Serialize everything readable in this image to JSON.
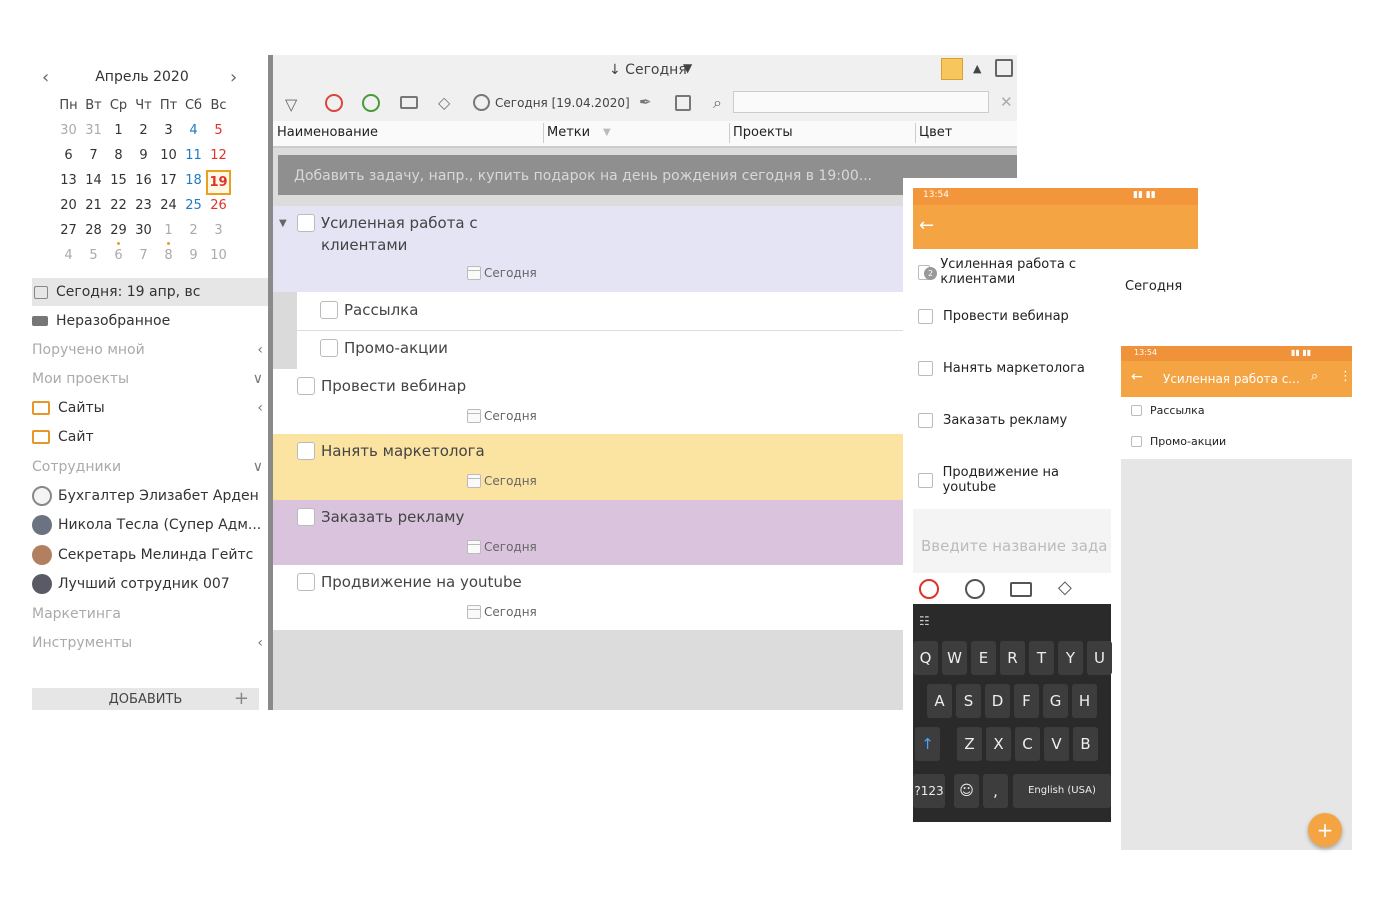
{
  "calendar": {
    "title": "Апрель 2020",
    "weekdays": [
      "Пн",
      "Вт",
      "Ср",
      "Чт",
      "Пт",
      "Сб",
      "Вс"
    ],
    "weeks": [
      [
        "30",
        "31",
        "1",
        "2",
        "3",
        "4",
        "5"
      ],
      [
        "6",
        "7",
        "8",
        "9",
        "10",
        "11",
        "12"
      ],
      [
        "13",
        "14",
        "15",
        "16",
        "17",
        "18",
        "19"
      ],
      [
        "20",
        "21",
        "22",
        "23",
        "24",
        "25",
        "26"
      ],
      [
        "27",
        "28",
        "29",
        "30",
        "1",
        "2",
        "3"
      ],
      [
        "4",
        "5",
        "6",
        "7",
        "8",
        "9",
        "10"
      ]
    ],
    "today": "19"
  },
  "sidebar": {
    "today": "Сегодня: 19 апр, вс",
    "unsorted": "Неразобранное",
    "assigned": "Поручено мной",
    "my_projects": "Мои проекты",
    "sites": "Сайты",
    "site": "Сайт",
    "employees": "Сотрудники",
    "people": [
      "Бухгалтер Элизабет Арден",
      "Никола Тесла (Супер Адм...",
      "Секретарь Мелинда Гейтс",
      "Лучший сотрудник 007"
    ],
    "marketing": "Маркетинга",
    "tools": "Инструменты",
    "add": "ДОБАВИТЬ"
  },
  "main": {
    "sort_label": "↓ Сегодня",
    "date_filter": "Сегодня [19.04.2020]",
    "columns": [
      "Наименование",
      "Метки",
      "Проекты",
      "Цвет"
    ],
    "add_placeholder": "Добавить задачу, напр., купить подарок на день рождения сегодня в 19:00...",
    "due": "Сегодня",
    "tasks": [
      {
        "title": "Усиленная работа с",
        "title2": "клиентами"
      },
      {
        "title": "Рассылка"
      },
      {
        "title": "Промо-акции"
      },
      {
        "title": "Провести вебинар"
      },
      {
        "title": "Нанять маркетолога"
      },
      {
        "title": "Заказать рекламу"
      },
      {
        "title": "Продвижение на youtube"
      }
    ]
  },
  "phone1": {
    "time": "13:54",
    "items": [
      "Усиленная работа с клиентами",
      "Провести вебинар",
      "Нанять маркетолога",
      "Заказать рекламу",
      "Продвижение на youtube"
    ],
    "due": "Сегодня",
    "badge": "2",
    "input_placeholder": "Введите название зада",
    "keys_row1": [
      "Q",
      "W",
      "E",
      "R",
      "T",
      "Y",
      "U"
    ],
    "keys_row2": [
      "A",
      "S",
      "D",
      "F",
      "G",
      "H"
    ],
    "keys_row3": [
      "Z",
      "X",
      "C",
      "V",
      "B"
    ],
    "key_123": "?123",
    "key_lang": "English (USA)"
  },
  "phone2": {
    "time": "13:54",
    "title": "Усиленная работа с...",
    "items": [
      "Рассылка",
      "Промо-акции"
    ],
    "fab": "+"
  },
  "colors": {
    "accent": "#f5a443",
    "row_blue": "#e4e4f5",
    "row_yellow": "#fbe3a2",
    "row_purple": "#d9c3dd",
    "today_border": "#e8a020"
  }
}
